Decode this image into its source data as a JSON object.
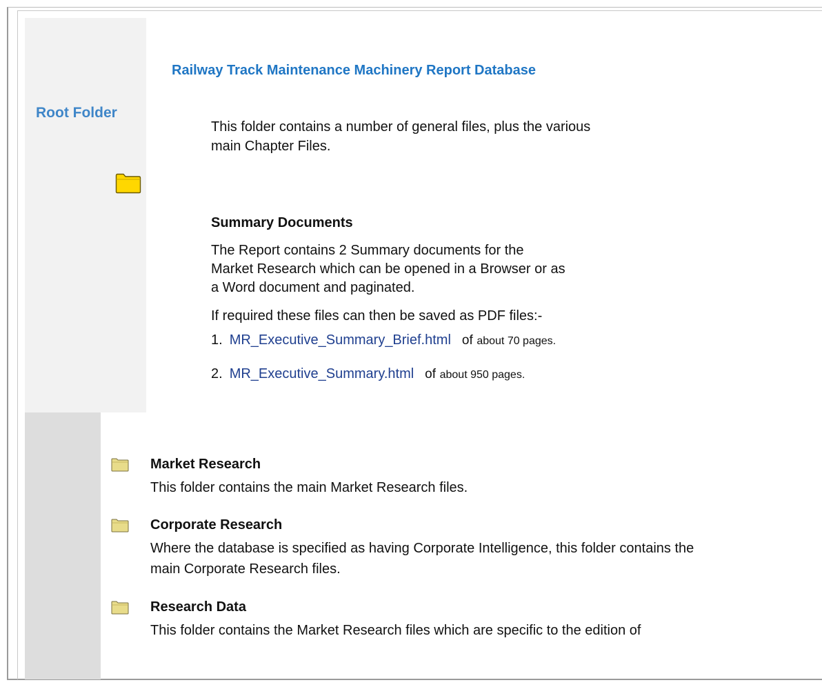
{
  "sidebar": {
    "root_label": "Root Folder"
  },
  "main": {
    "title": "Railway Track Maintenance Machinery Report Database",
    "intro": "This folder contains a number of general files, plus the various main Chapter Files.",
    "summary_heading": "Summary Documents",
    "summary_text": "The Report contains 2 Summary documents for the Market Research which can be opened in a Browser or as a Word document and paginated.",
    "pdf_text": "If required these files can then be saved as PDF files:-",
    "documents": [
      {
        "number": "1.",
        "link": "MR_Executive_Summary_Brief.html",
        "of": "of",
        "pages": "about 70 pages."
      },
      {
        "number": "2.",
        "link": "MR_Executive_Summary.html",
        "of": "of",
        "pages": "about 950 pages."
      }
    ]
  },
  "folders": [
    {
      "title": "Market Research",
      "description": "This folder contains the main Market Research files."
    },
    {
      "title": "Corporate Research",
      "description": "Where the database is specified as having Corporate Intelligence, this folder contains the main Corporate Research files."
    },
    {
      "title": "Research Data",
      "description": "This folder contains the Market Research files which are specific to the edition of"
    }
  ],
  "colors": {
    "title": "#1f76c4",
    "root_label": "#3f86c8",
    "link": "#1f3f8f",
    "folder_yellow": "#ffd700",
    "sidebar_bg": "#f2f2f2",
    "lower_bg": "#dddddd"
  }
}
